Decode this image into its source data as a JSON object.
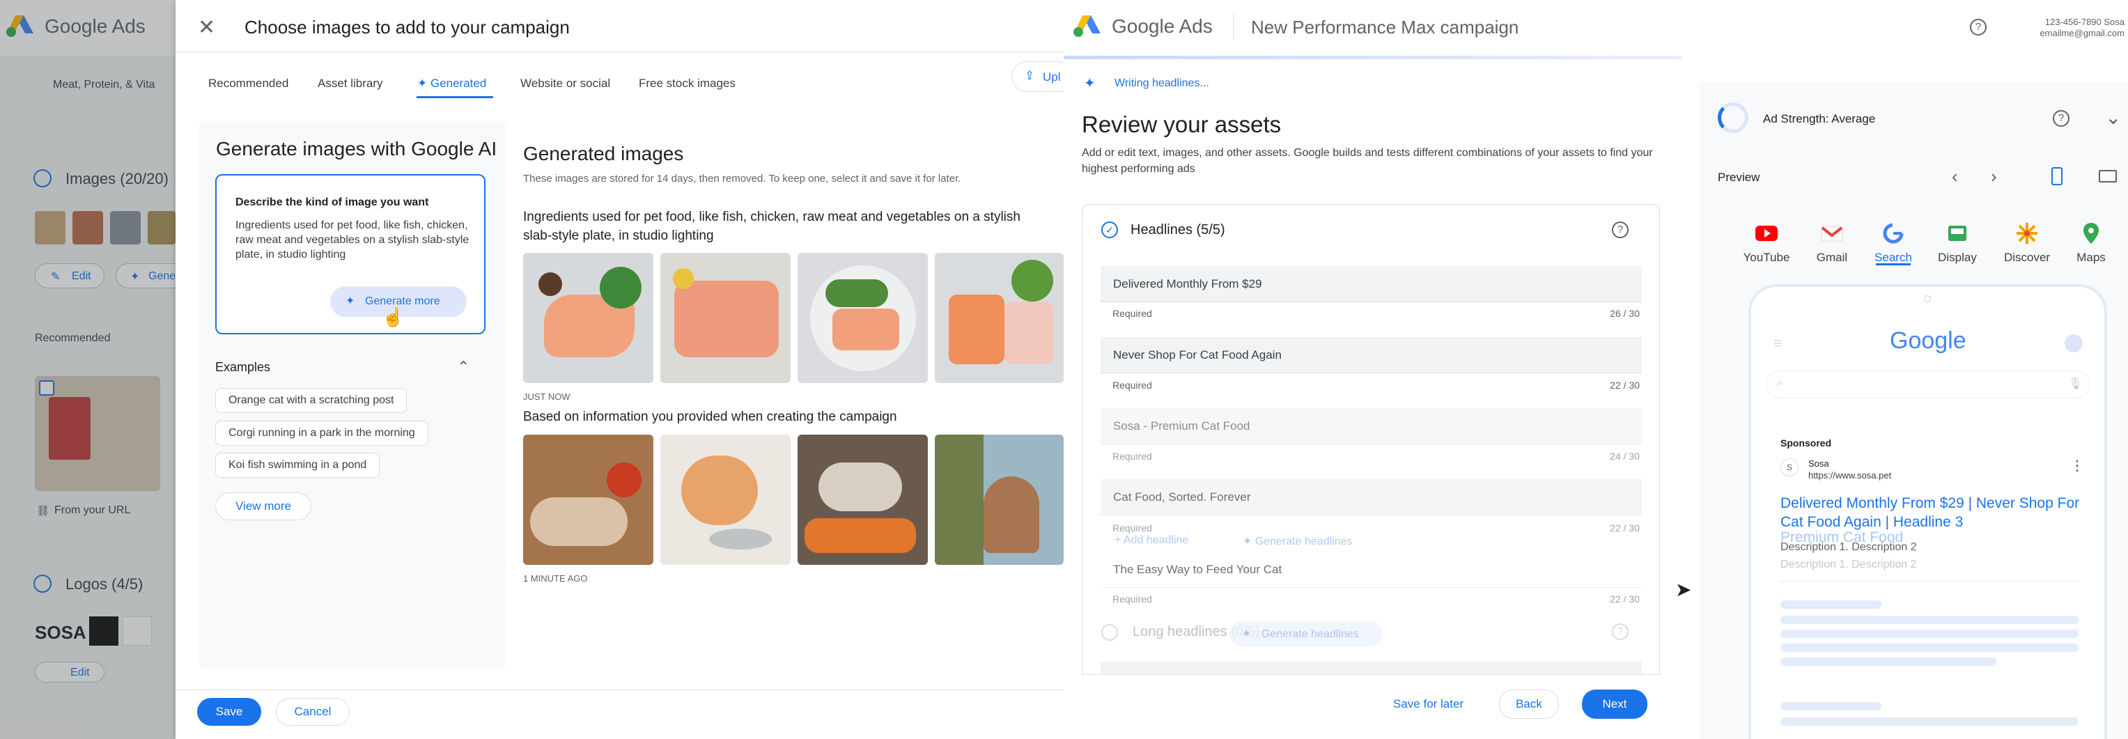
{
  "bg": {
    "brand": "Google Ads",
    "filter_chip": "Meat, Protein, & Vita",
    "images_section": "Images (20/20)",
    "edit_label": "Edit",
    "generate_label": "Gene",
    "recommended_label": "Recommended",
    "from_url_label": "From your URL",
    "logos_section": "Logos (4/5)",
    "sosa_logo_text": "SOSA",
    "logo_edit_label": "Edit"
  },
  "dialog": {
    "title": "Choose images to add to your campaign",
    "tabs": [
      "Recommended",
      "Asset library",
      "Generated",
      "Website or social",
      "Free stock images"
    ],
    "upload_label": "Upl",
    "gen_panel_title": "Generate images with Google AI",
    "prompt_label": "Describe the kind of image you want",
    "prompt_text": "Ingredients used for pet food, like fish, chicken, raw meat and vegetables on a stylish slab-style plate, in studio lighting",
    "generate_more_label": "Generate more",
    "examples_title": "Examples",
    "examples": [
      "Orange cat with a scratching post",
      "Corgi running in a park in the morning",
      "Koi fish swimming in a pond"
    ],
    "view_more_label": "View more",
    "generated_title": "Generated images",
    "generated_note": "These images are stored for 14 days, then removed. To keep one, select it and save it for later.",
    "group1_title": "Ingredients used for pet food, like fish, chicken, raw meat and vegetables on a stylish slab-style plate, in studio lighting",
    "group1_time": "JUST NOW",
    "group2_title": "Based on information you provided when creating the campaign",
    "group2_time": "1 MINUTE AGO",
    "save_label": "Save",
    "cancel_label": "Cancel"
  },
  "review": {
    "brand": "Google Ads",
    "campaign_title": "New Performance Max campaign",
    "account_phone": "123-456-7890 Sosa",
    "account_email": "emailme@gmail.com",
    "writing_status": "Writing headlines...",
    "heading": "Review your assets",
    "description": "Add or edit text, images, and other assets. Google builds and tests different combinations of your assets to find your highest performing ads",
    "headlines_section": "Headlines (5/5)",
    "headlines": [
      {
        "text": "Delivered Monthly From $29",
        "meta": "Required",
        "count": "26 / 30"
      },
      {
        "text": "Never Shop For Cat Food Again",
        "meta": "Required",
        "count": "22 / 30"
      },
      {
        "text": "Sosa - Premium Cat Food",
        "meta": "Required",
        "count": "24 / 30"
      },
      {
        "text": "Cat Food, Sorted. Forever",
        "meta": "Required",
        "count": "22 / 30"
      },
      {
        "text": "The Easy Way to Feed Your Cat",
        "meta": "Required",
        "count": "22 / 30"
      }
    ],
    "add_headline_label": "Add headline",
    "generate_headlines_label": "Generate headlines",
    "long_headlines_section": "Long headlines (0/5)",
    "generate_headlines_label2": "Generate headlines",
    "save_for_later_label": "Save for later",
    "back_label": "Back",
    "next_label": "Next",
    "ad_strength": "Ad Strength: Average",
    "preview_label": "Preview",
    "preview_tabs": [
      "YouTube",
      "Gmail",
      "Search",
      "Display",
      "Discover",
      "Maps"
    ],
    "phone": {
      "google_logo": "Google",
      "sponsored": "Sponsored",
      "advertiser": "Sosa",
      "url": "https://www.sosa.pet",
      "ad_headline": "Delivered Monthly From $29 | Never Shop For Cat Food Again | Headline 3",
      "ad_headline_ghost": "Premium Cat Food",
      "description1": "Description 1. Description 2",
      "description2": "Description 1. Description 2"
    }
  },
  "colors": {
    "accent": "#1a73e8",
    "ads_yellow": "#fbbc04",
    "ads_blue": "#4285f4",
    "ads_green": "#34a853"
  }
}
